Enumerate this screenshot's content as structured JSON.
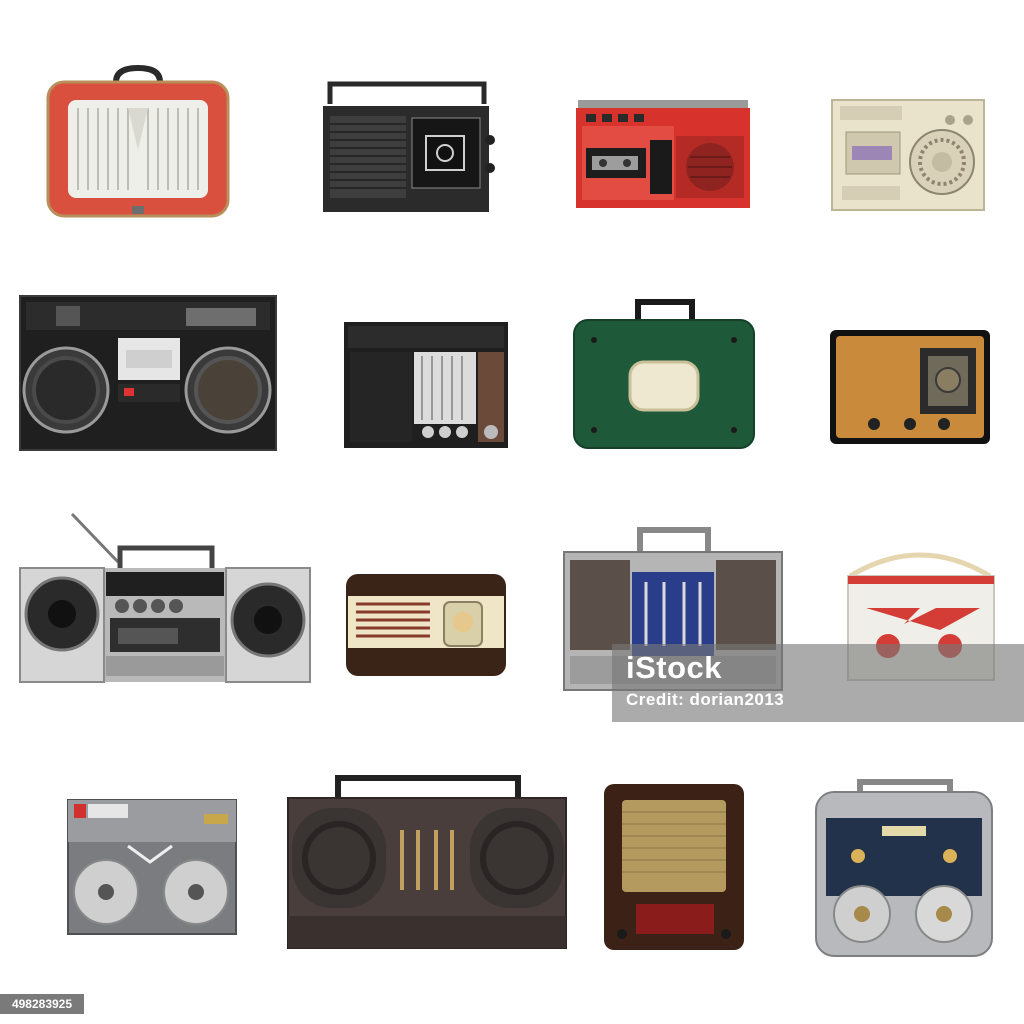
{
  "watermark": {
    "logo": "iStock",
    "credit": "Credit: dorian2013"
  },
  "image_id": "498283925",
  "colors": {
    "background": "#ffffff",
    "watermark_band": "#7a7a7a"
  },
  "items": [
    {
      "name": "red-suitcase-radio"
    },
    {
      "name": "black-portable-radio"
    },
    {
      "name": "red-cassette-recorder"
    },
    {
      "name": "beige-radio-cassette"
    },
    {
      "name": "black-stereo-boombox"
    },
    {
      "name": "black-transistor-radio"
    },
    {
      "name": "green-suitcase-radio"
    },
    {
      "name": "wooden-tube-radio"
    },
    {
      "name": "silver-boombox"
    },
    {
      "name": "ivory-bakelite-radio"
    },
    {
      "name": "silver-equalizer-boombox"
    },
    {
      "name": "red-white-reel-recorder"
    },
    {
      "name": "grey-reel-to-reel-recorder"
    },
    {
      "name": "brown-stereo-radio"
    },
    {
      "name": "wooden-cabinet-radio"
    },
    {
      "name": "blue-reel-to-reel-recorder"
    }
  ]
}
